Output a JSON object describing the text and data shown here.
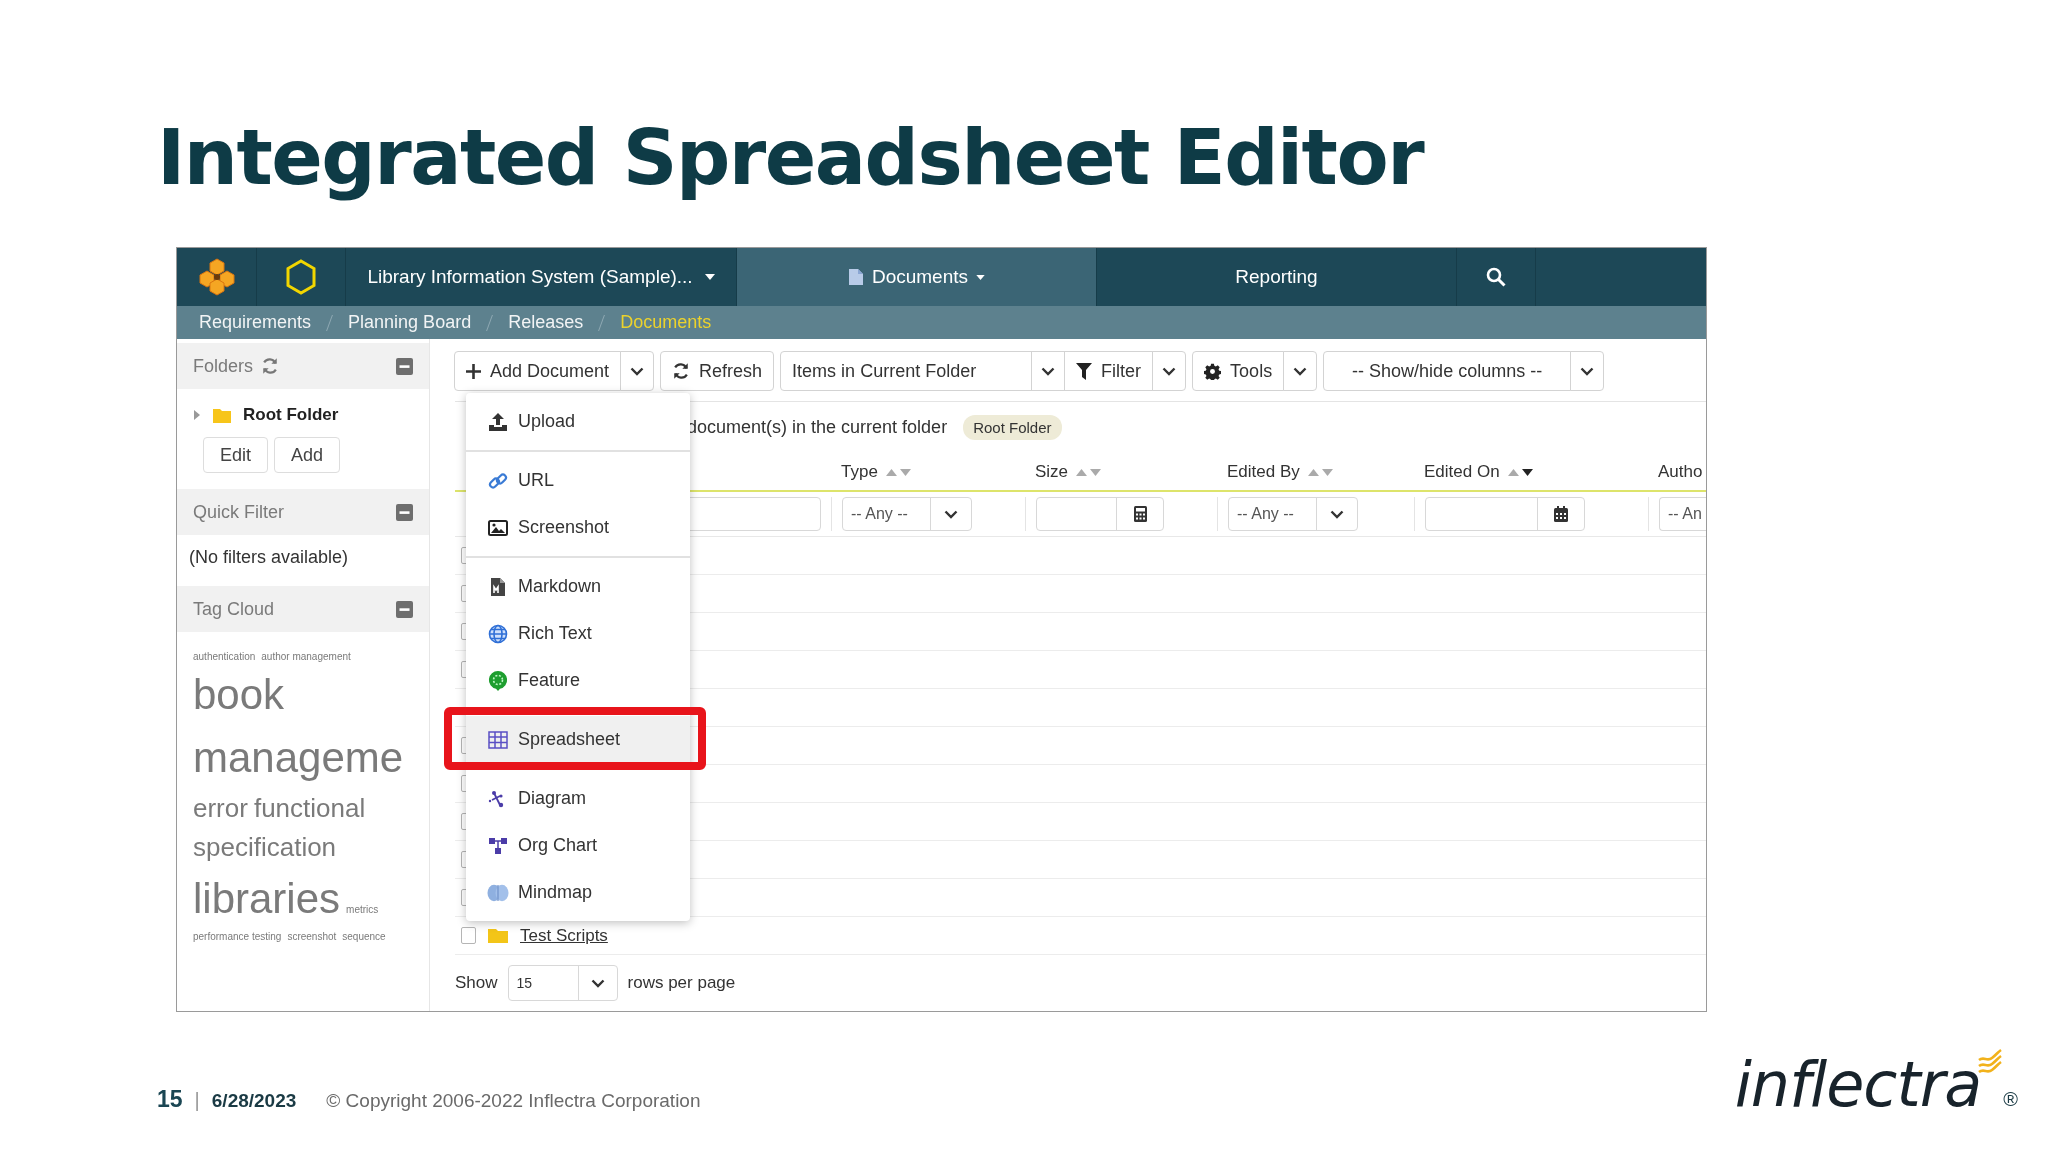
{
  "slide": {
    "title": "Integrated Spreadsheet Editor",
    "page_number": "15",
    "separator": "|",
    "date": "6/28/2023",
    "copyright": "© Copyright 2006-2022 Inflectra Corporation",
    "logo": {
      "name": "inflectra",
      "mark": "®"
    }
  },
  "app": {
    "nav": {
      "project": "Library Information System (Sample)...",
      "menus": [
        {
          "label": "Documents",
          "selected": true,
          "has_menu": true
        },
        {
          "label": "Reporting",
          "selected": false,
          "has_menu": false
        }
      ]
    },
    "breadcrumb": [
      {
        "label": "Requirements",
        "selected": false
      },
      {
        "label": "Planning Board",
        "selected": false
      },
      {
        "label": "Releases",
        "selected": false
      },
      {
        "label": "Documents",
        "selected": true
      }
    ],
    "sidebar": {
      "folders": {
        "title": "Folders",
        "items": [
          {
            "label": "Root Folder",
            "expanded": false
          }
        ],
        "buttons": [
          "Edit",
          "Add"
        ]
      },
      "quick_filter": {
        "title": "Quick Filter",
        "message": "(No filters available)"
      },
      "tag_cloud": {
        "title": "Tag Cloud",
        "tags": [
          {
            "label": "authentication",
            "kind": "tiny"
          },
          {
            "label": "author management",
            "kind": "tiny"
          },
          {
            "label": "book",
            "kind": "large"
          },
          {
            "label": "manageme",
            "kind": "large"
          },
          {
            "label": "error",
            "kind": "medium"
          },
          {
            "label": "functional",
            "kind": "medium"
          },
          {
            "label": "specification",
            "kind": "medium"
          },
          {
            "label": "libraries",
            "kind": "large"
          },
          {
            "label": "metrics",
            "kind": "tiny"
          },
          {
            "label": "performance testing",
            "kind": "tiny"
          },
          {
            "label": "screenshot",
            "kind": "tiny"
          },
          {
            "label": "sequence",
            "kind": "tiny"
          }
        ]
      }
    },
    "toolbar": {
      "add": "Add Document",
      "refresh": "Refresh",
      "view": "Items in Current Folder",
      "filter": "Filter",
      "tools": "Tools",
      "columns": "-- Show/hide columns --"
    },
    "info": {
      "text": "document(s) in the current folder",
      "folder_tag": "Root Folder"
    },
    "table": {
      "columns": [
        {
          "label": "Type",
          "sorted": false
        },
        {
          "label": "Size",
          "sorted": false
        },
        {
          "label": "Edited By",
          "sorted": false
        },
        {
          "label": "Edited On",
          "sorted": true
        },
        {
          "label": "Autho"
        }
      ],
      "filters": [
        {
          "kind": "text"
        },
        {
          "kind": "select",
          "value": "-- Any --"
        },
        {
          "kind": "number"
        },
        {
          "kind": "select",
          "value": "-- Any --"
        },
        {
          "kind": "date"
        },
        {
          "kind": "select",
          "value": "-- An"
        }
      ],
      "rows": [
        {
          "kind": "checkbox",
          "checked": false
        },
        {
          "kind": "checkbox",
          "checked": false
        },
        {
          "kind": "checkbox",
          "checked": false
        },
        {
          "kind": "checkbox",
          "checked": false
        },
        {
          "kind": "blank"
        },
        {
          "kind": "checkbox",
          "checked": false
        },
        {
          "kind": "checkbox",
          "checked": false
        },
        {
          "kind": "checkbox",
          "checked": false
        },
        {
          "kind": "checkbox",
          "checked": false
        },
        {
          "kind": "checkbox",
          "checked": false
        },
        {
          "kind": "checkbox",
          "checked": false,
          "name": "Test Scripts"
        }
      ]
    },
    "pager": {
      "label": "Show",
      "value": "15",
      "suffix": "rows per page"
    },
    "dropdown": {
      "groups": [
        {
          "items": [
            {
              "label": "Upload",
              "kind": "upload",
              "selected": false
            }
          ]
        },
        {
          "items": [
            {
              "label": "URL",
              "kind": "url",
              "selected": false
            },
            {
              "label": "Screenshot",
              "kind": "screenshot",
              "selected": false
            }
          ]
        },
        {
          "items": [
            {
              "label": "Markdown",
              "kind": "markdown",
              "selected": false
            },
            {
              "label": "Rich Text",
              "kind": "richtext",
              "selected": false
            },
            {
              "label": "Feature",
              "kind": "feature",
              "selected": false
            }
          ]
        },
        {
          "items": [
            {
              "label": "Spreadsheet",
              "kind": "spreadsheet",
              "selected": true
            }
          ]
        },
        {
          "items": [
            {
              "label": "Diagram",
              "kind": "diagram",
              "selected": false
            },
            {
              "label": "Org Chart",
              "kind": "orgchart",
              "selected": false
            },
            {
              "label": "Mindmap",
              "kind": "mindmap",
              "selected": false
            }
          ]
        }
      ]
    }
  }
}
